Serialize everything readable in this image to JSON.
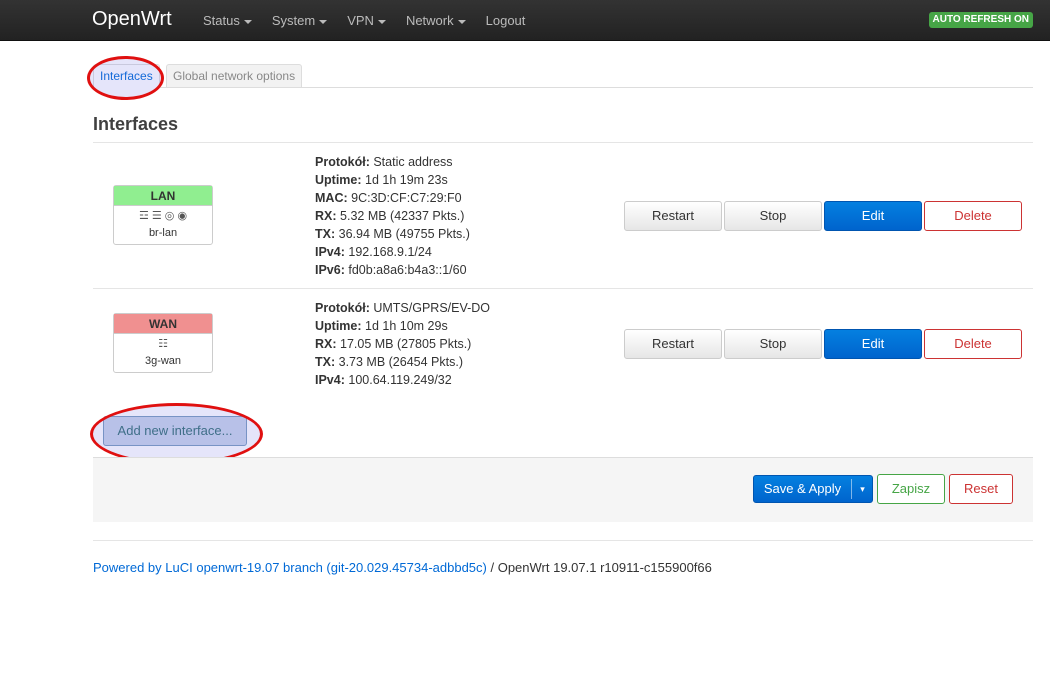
{
  "navbar": {
    "brand": "OpenWrt",
    "menu": [
      {
        "label": "Status",
        "dropdown": true
      },
      {
        "label": "System",
        "dropdown": true
      },
      {
        "label": "VPN",
        "dropdown": true
      },
      {
        "label": "Network",
        "dropdown": true
      },
      {
        "label": "Logout",
        "dropdown": false
      }
    ],
    "auto_refresh": "AUTO REFRESH ON"
  },
  "tabs": [
    {
      "label": "Interfaces",
      "active": true
    },
    {
      "label": "Global network options",
      "active": false
    }
  ],
  "section_title": "Interfaces",
  "interfaces": [
    {
      "name": "LAN",
      "color": "#90ee90",
      "device": "br-lan",
      "icons": "☲ ☰ ◎ ◉",
      "info": [
        {
          "label": "Protokół:",
          "value": "Static address"
        },
        {
          "label": "Uptime:",
          "value": "1d 1h 19m 23s"
        },
        {
          "label": "MAC:",
          "value": "9C:3D:CF:C7:29:F0"
        },
        {
          "label": "RX:",
          "value": "5.32 MB (42337 Pkts.)"
        },
        {
          "label": "TX:",
          "value": "36.94 MB (49755 Pkts.)"
        },
        {
          "label": "IPv4:",
          "value": "192.168.9.1/24"
        },
        {
          "label": "IPv6:",
          "value": "fd0b:a8a6:b4a3::1/60"
        }
      ]
    },
    {
      "name": "WAN",
      "color": "#f09090",
      "device": "3g-wan",
      "icons": "☷",
      "info": [
        {
          "label": "Protokół:",
          "value": "UMTS/GPRS/EV-DO"
        },
        {
          "label": "Uptime:",
          "value": "1d 1h 10m 29s"
        },
        {
          "label": "RX:",
          "value": "17.05 MB (27805 Pkts.)"
        },
        {
          "label": "TX:",
          "value": "3.73 MB (26454 Pkts.)"
        },
        {
          "label": "IPv4:",
          "value": "100.64.119.249/32"
        }
      ]
    }
  ],
  "row_buttons": {
    "restart": "Restart",
    "stop": "Stop",
    "edit": "Edit",
    "delete": "Delete"
  },
  "add_interface": "Add new interface...",
  "actions": {
    "save_apply": "Save & Apply",
    "dropdown_arrow": "▾",
    "save": "Zapisz",
    "reset": "Reset"
  },
  "footer": {
    "link": "Powered by LuCI openwrt-19.07 branch (git-20.029.45734-adbbd5c)",
    "text": " / OpenWrt 19.07.1 r10911-c155900f66"
  },
  "colors": {
    "accent": "#0069d6",
    "danger": "#cc3333",
    "success": "#46a546",
    "navbar": "#222222"
  }
}
